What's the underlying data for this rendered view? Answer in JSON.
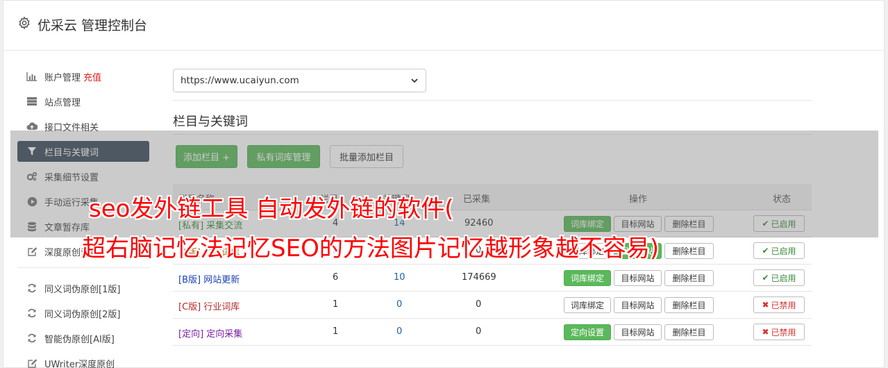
{
  "header": {
    "title": "优采云 管理控制台"
  },
  "sidebar": {
    "items": [
      {
        "label": "账户管理",
        "extra": "充值",
        "icon": "bar-chart-icon"
      },
      {
        "label": "站点管理",
        "icon": "server-icon"
      },
      {
        "label": "接口文件相关",
        "icon": "cloud-upload-icon"
      },
      {
        "label": "栏目与关键词",
        "icon": "filter-icon",
        "active": true
      },
      {
        "label": "采集细节设置",
        "icon": "cogs-icon"
      },
      {
        "label": "手动运行采集",
        "icon": "play-circle-icon"
      },
      {
        "label": "文章暂存库",
        "icon": "database-icon"
      },
      {
        "label": "深度原创设置",
        "icon": "edit-icon"
      }
    ],
    "items2": [
      {
        "label": "同义词伪原创[1版]",
        "icon": "refresh-icon"
      },
      {
        "label": "同义词伪原创[2版]",
        "icon": "refresh-icon"
      },
      {
        "label": "智能伪原创[AI版]",
        "icon": "refresh-icon"
      },
      {
        "label": "UWriter深度原创",
        "icon": "edit-icon"
      }
    ]
  },
  "main": {
    "site_select": "https://www.ucaiyun.com",
    "section_title": "栏目与关键词",
    "buttons": {
      "add_column": "添加栏目 +",
      "private_lib": "私有词库管理",
      "batch_add": "批量添加栏目"
    },
    "table": {
      "headers": {
        "name": "栏目名称",
        "lib": "栏目",
        "kw": "关键词",
        "articles": "已采集",
        "ops": "操作",
        "status": "状态"
      },
      "rows": [
        {
          "tag": "[私有]",
          "name": "采集交流",
          "c1": "4",
          "c2": "14",
          "c3": "92460",
          "op1": "词库绑定",
          "op2": "目标网站",
          "op3": "删除栏目",
          "status": "已启用",
          "on": true
        },
        {
          "tag": "[A版]",
          "name": "公有词库",
          "c1": "1",
          "c2": "0",
          "c3": "0",
          "op1": "词库绑定",
          "op2": "目标网站",
          "op3": "删除栏目",
          "status": "已启用",
          "on": true
        },
        {
          "tag": "[B版]",
          "name": "网站更新",
          "c1": "6",
          "c2": "10",
          "c3": "174669",
          "op1": "词库绑定",
          "op2": "目标网站",
          "op3": "删除栏目",
          "status": "已启用",
          "on": true
        },
        {
          "tag": "[C版]",
          "name": "行业词库",
          "c1": "1",
          "c2": "0",
          "c3": "0",
          "op1": "词库绑定",
          "op2": "目标网站",
          "op3": "删除栏目",
          "status": "已禁用",
          "on": false
        },
        {
          "tag": "[定向]",
          "name": "定向采集",
          "c1": "1",
          "c2": "0",
          "c3": "0",
          "op1": "定向设置",
          "op2": "目标网站",
          "op3": "删除栏目",
          "status": "已禁用",
          "on": false
        }
      ]
    }
  },
  "overlay": {
    "line1": "seo发外链工具 自动发外链的软件(",
    "line2": "超右脑记忆法记忆SEO的方法图片记忆越形象越不容易)"
  },
  "colors": {
    "active_nav": "#3c4b5c",
    "green": "#5cb85c",
    "overlay_text": "#ff0000",
    "recharge": "#e02020"
  }
}
